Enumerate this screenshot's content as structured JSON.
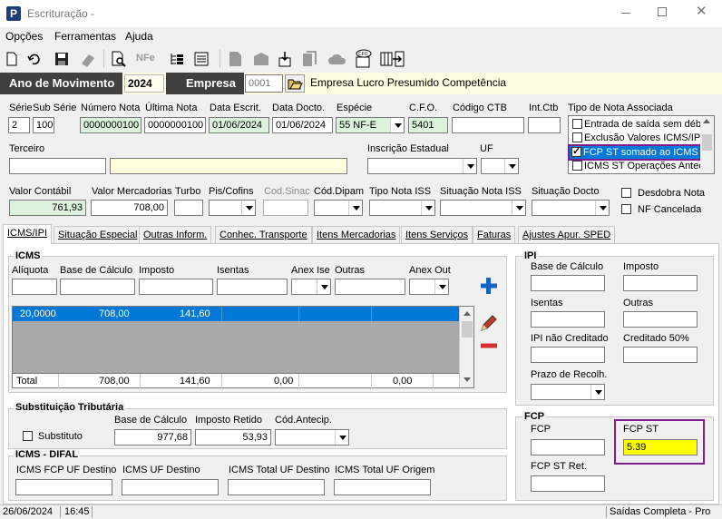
{
  "window": {
    "title": "Escrituração -"
  },
  "menu": [
    "Opções",
    "Ferramentas",
    "Ajuda"
  ],
  "header": {
    "ano_label": "Ano de Movimento",
    "ano_value": "2024",
    "empresa_label": "Empresa",
    "empresa_code": "0001",
    "empresa_name": "Empresa Lucro Presumido Competência"
  },
  "row1": {
    "serie_label": "Série",
    "serie": "2",
    "subserie_label": "Sub Série",
    "subserie": "100",
    "numero_label": "Número Nota",
    "numero": "0000000100",
    "ultima_label": "Última Nota",
    "ultima": "0000000100",
    "data_escrit_label": "Data Escrit.",
    "data_escrit": "01/06/2024",
    "data_docto_label": "Data Docto.",
    "data_docto": "01/06/2024",
    "especie_label": "Espécie",
    "especie": "55   NF-E",
    "cfo_label": "C.F.O.",
    "cfo": "5401",
    "codigo_ctb_label": "Código CTB",
    "codigo_ctb": "",
    "intctb_label": "Int.Ctb",
    "intctb": "",
    "tipo_nota_label": "Tipo de Nota Associada"
  },
  "tipo_nota_list": [
    {
      "label": "Entrada de saída sem débi",
      "checked": false
    },
    {
      "label": "Exclusão Valores ICMS/IPI",
      "checked": false
    },
    {
      "label": "FCP ST somado ao ICMS S",
      "checked": true
    },
    {
      "label": "ICMS ST Operações Antec",
      "checked": false
    }
  ],
  "row2": {
    "terceiro_label": "Terceiro",
    "inscricao_label": "Inscrição Estadual",
    "uf_label": "UF"
  },
  "row3": {
    "valor_contabil_label": "Valor Contábil",
    "valor_contabil": "761,93",
    "valor_merc_label": "Valor Mercadorias",
    "valor_merc": "708,00",
    "turbo_label": "Turbo",
    "pis_label": "Pis/Cofins",
    "cod_sinac_label": "Cod.Sinac",
    "cod_dipam_label": "Cód.Dipam",
    "tipo_iss_label": "Tipo Nota ISS",
    "sit_iss_label": "Situação Nota ISS",
    "sit_docto_label": "Situação Docto",
    "desdobra_label": "Desdobra Nota",
    "nf_cancelada_label": "NF Cancelada"
  },
  "tabs": [
    "ICMS/IPI",
    "Situação Especial",
    "Outras Inform.",
    "Conhec. Transporte",
    "Itens Mercadorias",
    "Itens Serviços",
    "Faturas",
    "Ajustes Apur. SPED"
  ],
  "icms": {
    "title": "ICMS",
    "aliquota_label": "Alíquota",
    "base_label": "Base de Cálculo",
    "imposto_label": "Imposto",
    "isentas_label": "Isentas",
    "anex_ise_label": "Anex Ise",
    "outras_label": "Outras",
    "anex_out_label": "Anex Out",
    "grid_row": [
      "20,0000",
      "708,00",
      "141,60"
    ],
    "total_label": "Total",
    "total_base": "708,00",
    "total_imposto": "141,60",
    "total_isentas": "0,00",
    "total_outras": "0,00"
  },
  "st": {
    "title": "Substituição Tributária",
    "substituto_label": "Substituto",
    "base_label": "Base de Cálculo",
    "base": "977,68",
    "imposto_label": "Imposto Retido",
    "imposto": "53,93",
    "cod_antecip_label": "Cód.Antecip."
  },
  "difal": {
    "title": "ICMS - DIFAL",
    "fcp_uf_label": "ICMS FCP UF Destino",
    "uf_destino_label": "ICMS UF Destino",
    "total_uf_destino_label": "ICMS Total UF Destino",
    "total_uf_origem_label": "ICMS Total UF Origem"
  },
  "ipi": {
    "title": "IPI",
    "base_label": "Base de Cálculo",
    "imposto_label": "Imposto",
    "isentas_label": "Isentas",
    "outras_label": "Outras",
    "nao_creditado_label": "IPI não Creditado",
    "creditado_label": "Creditado 50%",
    "prazo_label": "Prazo de Recolh."
  },
  "fcp": {
    "title": "FCP",
    "fcp_label": "FCP",
    "fcp_st_label": "FCP ST",
    "fcp_st": "5.39",
    "fcp_st_ret_label": "FCP ST Ret."
  },
  "status": {
    "date": "26/06/2024",
    "time": "16:45",
    "right": "Saídas Completa - Pros"
  },
  "colors": {
    "header_dark": "#404040",
    "grid_selected": "#0078d7",
    "highlight_border": "#7b1f8a",
    "blue_plus": "#1565c0",
    "red_minus": "#d32f2f"
  }
}
